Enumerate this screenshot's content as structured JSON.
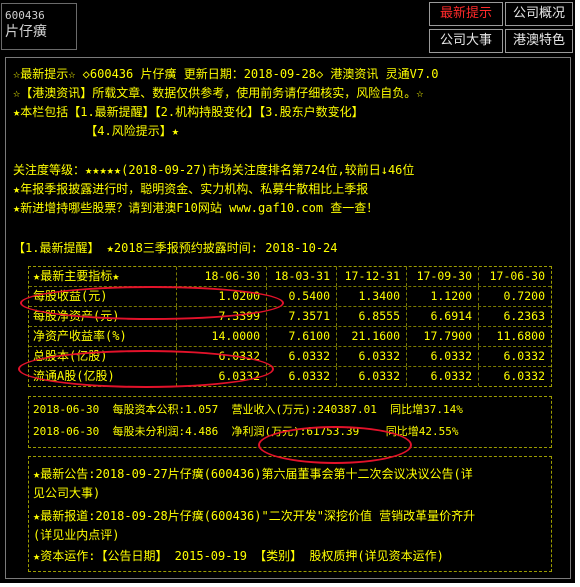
{
  "stock": {
    "code": "600436",
    "name": "片仔癀"
  },
  "nav": {
    "latest": "最新提示",
    "company_overview": "公司概况",
    "company_events": "公司大事",
    "hk_features": "港澳特色"
  },
  "intro": {
    "line1": "☆最新提示☆ ◇600436 片仔癀 更新日期：2018-09-28◇ 港澳资讯 灵通V7.0",
    "line2": "☆【港澳资讯】所载文章、数据仅供参考，使用前务请仔细核实，风险自负。☆",
    "line3": "★本栏包括【1.最新提醒】【2.机构持股变化】【3.股东户数变化】",
    "line4": "          【4.风险提示】★"
  },
  "attention": {
    "line1": "关注度等级：★★★★★(2018-09-27)市场关注度排名第724位,较前日↓46位",
    "line2": "★年报季报披露进行时，聪明资金、实力机构、私募牛散相比上季报",
    "line3": "★新进增持哪些股票？请到港澳F10网站 www.gaf10.com 查一查！"
  },
  "section": {
    "heading": "【1.最新提醒】 ★2018三季报预约披露时间: 2018-10-24"
  },
  "table": {
    "header": [
      "★最新主要指标★",
      "18-06-30",
      "18-03-31",
      "17-12-31",
      "17-09-30",
      "17-06-30"
    ],
    "rows": [
      [
        "每股收益(元)",
        "1.0200",
        "0.5400",
        "1.3400",
        "1.1200",
        "0.7200"
      ],
      [
        "每股净资产(元)",
        "7.3399",
        "7.3571",
        "6.8555",
        "6.6914",
        "6.2363"
      ],
      [
        "净资产收益率(%)",
        "14.0000",
        "7.6100",
        "21.1600",
        "17.7900",
        "11.6800"
      ],
      [
        "总股本(亿股)",
        "6.0332",
        "6.0332",
        "6.0332",
        "6.0332",
        "6.0332"
      ],
      [
        "流通A股(亿股)",
        "6.0332",
        "6.0332",
        "6.0332",
        "6.0332",
        "6.0332"
      ]
    ]
  },
  "summary": {
    "line1": "2018-06-30  每股资本公积:1.057  营业收入(万元):240387.01  同比增37.14%",
    "line2": "2018-06-30  每股未分利润:4.486  净利润(万元):61753.39    同比增42.55%"
  },
  "news": {
    "line1": "★最新公告:2018-09-27片仔癀(600436)第六届董事会第十二次会议决议公告(详",
    "line2": "见公司大事)",
    "line3": "★最新报道:2018-09-28片仔癀(600436)\"二次开发\"深挖价值 营销改革量价齐升",
    "line4": "(详见业内点评)",
    "line5": "★资本运作:【公告日期】 2015-09-19 【类别】 股权质押(详见资本运作)"
  },
  "colors": {
    "text": "#ffff00",
    "alert": "#ff2a2a",
    "annotation": "#e3122a",
    "background": "#000000"
  }
}
